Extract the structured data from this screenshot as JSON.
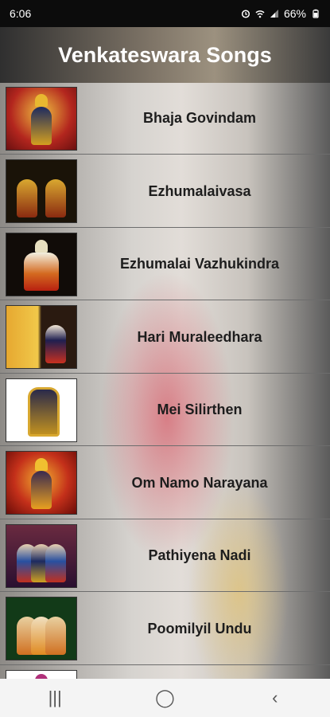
{
  "status": {
    "time": "6:06",
    "battery": "66%"
  },
  "header": {
    "title": "Venkateswara Songs"
  },
  "songs": [
    {
      "label": "Bhaja Govindam"
    },
    {
      "label": "Ezhumalaivasa"
    },
    {
      "label": "Ezhumalai Vazhukindra"
    },
    {
      "label": "Hari Muraleedhara"
    },
    {
      "label": "Mei Silirthen"
    },
    {
      "label": "Om Namo Narayana"
    },
    {
      "label": "Pathiyena Nadi"
    },
    {
      "label": "Poomilyil Undu"
    }
  ],
  "nav": {
    "recents": "|||",
    "home": "◯",
    "back": "‹"
  },
  "icons": {
    "alarm": "alarm-icon",
    "wifi": "wifi-icon",
    "signal": "signal-icon",
    "battery": "battery-icon"
  },
  "colors": {
    "status_bar": "#0c0c0c",
    "nav_bar": "#f4f4f4"
  }
}
